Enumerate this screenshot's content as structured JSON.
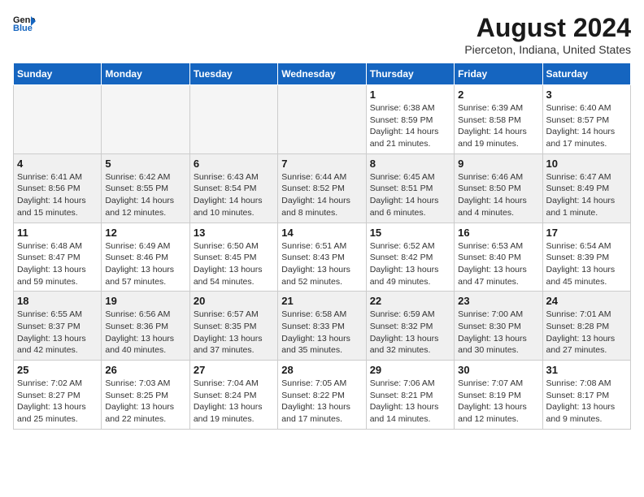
{
  "header": {
    "logo_line1": "General",
    "logo_line2": "Blue",
    "title": "August 2024",
    "subtitle": "Pierceton, Indiana, United States"
  },
  "weekdays": [
    "Sunday",
    "Monday",
    "Tuesday",
    "Wednesday",
    "Thursday",
    "Friday",
    "Saturday"
  ],
  "weeks": [
    [
      {
        "day": "",
        "info": ""
      },
      {
        "day": "",
        "info": ""
      },
      {
        "day": "",
        "info": ""
      },
      {
        "day": "",
        "info": ""
      },
      {
        "day": "1",
        "info": "Sunrise: 6:38 AM\nSunset: 8:59 PM\nDaylight: 14 hours\nand 21 minutes."
      },
      {
        "day": "2",
        "info": "Sunrise: 6:39 AM\nSunset: 8:58 PM\nDaylight: 14 hours\nand 19 minutes."
      },
      {
        "day": "3",
        "info": "Sunrise: 6:40 AM\nSunset: 8:57 PM\nDaylight: 14 hours\nand 17 minutes."
      }
    ],
    [
      {
        "day": "4",
        "info": "Sunrise: 6:41 AM\nSunset: 8:56 PM\nDaylight: 14 hours\nand 15 minutes."
      },
      {
        "day": "5",
        "info": "Sunrise: 6:42 AM\nSunset: 8:55 PM\nDaylight: 14 hours\nand 12 minutes."
      },
      {
        "day": "6",
        "info": "Sunrise: 6:43 AM\nSunset: 8:54 PM\nDaylight: 14 hours\nand 10 minutes."
      },
      {
        "day": "7",
        "info": "Sunrise: 6:44 AM\nSunset: 8:52 PM\nDaylight: 14 hours\nand 8 minutes."
      },
      {
        "day": "8",
        "info": "Sunrise: 6:45 AM\nSunset: 8:51 PM\nDaylight: 14 hours\nand 6 minutes."
      },
      {
        "day": "9",
        "info": "Sunrise: 6:46 AM\nSunset: 8:50 PM\nDaylight: 14 hours\nand 4 minutes."
      },
      {
        "day": "10",
        "info": "Sunrise: 6:47 AM\nSunset: 8:49 PM\nDaylight: 14 hours\nand 1 minute."
      }
    ],
    [
      {
        "day": "11",
        "info": "Sunrise: 6:48 AM\nSunset: 8:47 PM\nDaylight: 13 hours\nand 59 minutes."
      },
      {
        "day": "12",
        "info": "Sunrise: 6:49 AM\nSunset: 8:46 PM\nDaylight: 13 hours\nand 57 minutes."
      },
      {
        "day": "13",
        "info": "Sunrise: 6:50 AM\nSunset: 8:45 PM\nDaylight: 13 hours\nand 54 minutes."
      },
      {
        "day": "14",
        "info": "Sunrise: 6:51 AM\nSunset: 8:43 PM\nDaylight: 13 hours\nand 52 minutes."
      },
      {
        "day": "15",
        "info": "Sunrise: 6:52 AM\nSunset: 8:42 PM\nDaylight: 13 hours\nand 49 minutes."
      },
      {
        "day": "16",
        "info": "Sunrise: 6:53 AM\nSunset: 8:40 PM\nDaylight: 13 hours\nand 47 minutes."
      },
      {
        "day": "17",
        "info": "Sunrise: 6:54 AM\nSunset: 8:39 PM\nDaylight: 13 hours\nand 45 minutes."
      }
    ],
    [
      {
        "day": "18",
        "info": "Sunrise: 6:55 AM\nSunset: 8:37 PM\nDaylight: 13 hours\nand 42 minutes."
      },
      {
        "day": "19",
        "info": "Sunrise: 6:56 AM\nSunset: 8:36 PM\nDaylight: 13 hours\nand 40 minutes."
      },
      {
        "day": "20",
        "info": "Sunrise: 6:57 AM\nSunset: 8:35 PM\nDaylight: 13 hours\nand 37 minutes."
      },
      {
        "day": "21",
        "info": "Sunrise: 6:58 AM\nSunset: 8:33 PM\nDaylight: 13 hours\nand 35 minutes."
      },
      {
        "day": "22",
        "info": "Sunrise: 6:59 AM\nSunset: 8:32 PM\nDaylight: 13 hours\nand 32 minutes."
      },
      {
        "day": "23",
        "info": "Sunrise: 7:00 AM\nSunset: 8:30 PM\nDaylight: 13 hours\nand 30 minutes."
      },
      {
        "day": "24",
        "info": "Sunrise: 7:01 AM\nSunset: 8:28 PM\nDaylight: 13 hours\nand 27 minutes."
      }
    ],
    [
      {
        "day": "25",
        "info": "Sunrise: 7:02 AM\nSunset: 8:27 PM\nDaylight: 13 hours\nand 25 minutes."
      },
      {
        "day": "26",
        "info": "Sunrise: 7:03 AM\nSunset: 8:25 PM\nDaylight: 13 hours\nand 22 minutes."
      },
      {
        "day": "27",
        "info": "Sunrise: 7:04 AM\nSunset: 8:24 PM\nDaylight: 13 hours\nand 19 minutes."
      },
      {
        "day": "28",
        "info": "Sunrise: 7:05 AM\nSunset: 8:22 PM\nDaylight: 13 hours\nand 17 minutes."
      },
      {
        "day": "29",
        "info": "Sunrise: 7:06 AM\nSunset: 8:21 PM\nDaylight: 13 hours\nand 14 minutes."
      },
      {
        "day": "30",
        "info": "Sunrise: 7:07 AM\nSunset: 8:19 PM\nDaylight: 13 hours\nand 12 minutes."
      },
      {
        "day": "31",
        "info": "Sunrise: 7:08 AM\nSunset: 8:17 PM\nDaylight: 13 hours\nand 9 minutes."
      }
    ]
  ]
}
